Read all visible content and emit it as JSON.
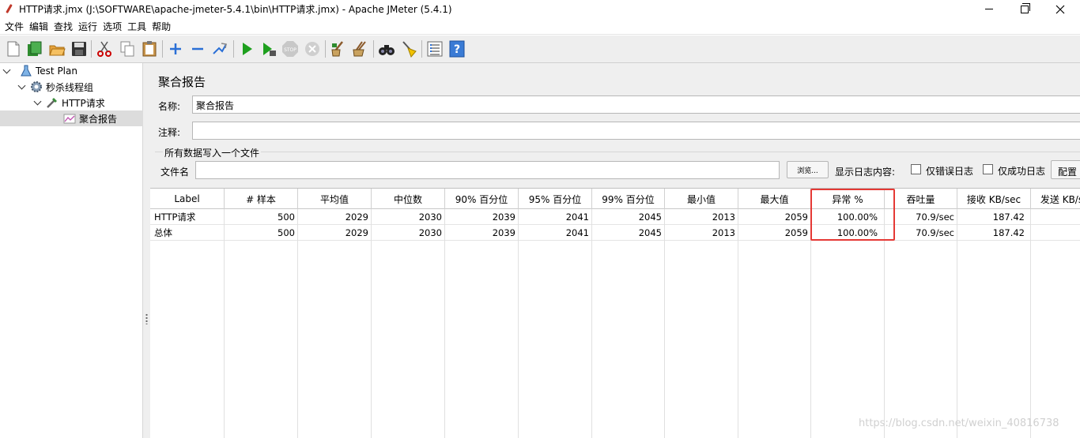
{
  "window": {
    "title": "HTTP请求.jmx (J:\\SOFTWARE\\apache-jmeter-5.4.1\\bin\\HTTP请求.jmx) - Apache JMeter (5.4.1)"
  },
  "menu": [
    "文件",
    "编辑",
    "查找",
    "运行",
    "选项",
    "工具",
    "帮助"
  ],
  "toolbar": {
    "icons": [
      "new-icon",
      "templates-icon",
      "open-icon",
      "save-icon",
      "cut-icon",
      "copy-icon",
      "paste-icon",
      "expand-icon",
      "collapse-icon",
      "toggle-icon",
      "start-icon",
      "start-no-pause-icon",
      "stop-icon",
      "shutdown-icon",
      "clear-icon",
      "clear-all-icon",
      "search-icon",
      "reset-search-icon",
      "function-helper-icon",
      "help-icon"
    ],
    "stop_label": "STOP"
  },
  "tree": [
    {
      "label": "Test Plan",
      "icon": "test-plan-icon"
    },
    {
      "label": "秒杀线程组",
      "icon": "thread-group-gear-icon"
    },
    {
      "label": "HTTP请求",
      "icon": "http-sampler-pipette-icon"
    },
    {
      "label": "聚合报告",
      "icon": "aggregate-report-chart-icon"
    }
  ],
  "panel": {
    "title": "聚合报告",
    "name_label": "名称:",
    "name_value": "聚合报告",
    "comment_label": "注释:",
    "comment_value": "",
    "group_title": "所有数据写入一个文件",
    "filename_label": "文件名",
    "filename_value": "",
    "browse_label": "浏览...",
    "log_content_label": "显示日志内容:",
    "errors_only_label": "仅错误日志",
    "success_only_label": "仅成功日志",
    "config_label": "配置"
  },
  "table": {
    "headers": [
      "Label",
      "# 样本",
      "平均值",
      "中位数",
      "90% 百分位",
      "95% 百分位",
      "99% 百分位",
      "最小值",
      "最大值",
      "异常 %",
      "吞吐量",
      "接收 KB/sec",
      "发送 KB/sec"
    ],
    "rows": [
      [
        "HTTP请求",
        "500",
        "2029",
        "2030",
        "2039",
        "2041",
        "2045",
        "2013",
        "2059",
        "100.00%",
        "70.9/sec",
        "187.42",
        ""
      ],
      [
        "总体",
        "500",
        "2029",
        "2030",
        "2039",
        "2041",
        "2045",
        "2013",
        "2059",
        "100.00%",
        "70.9/sec",
        "187.42",
        ""
      ]
    ],
    "highlight_color": "#e53935"
  },
  "watermark": "https://blog.csdn.net/weixin_40816738"
}
